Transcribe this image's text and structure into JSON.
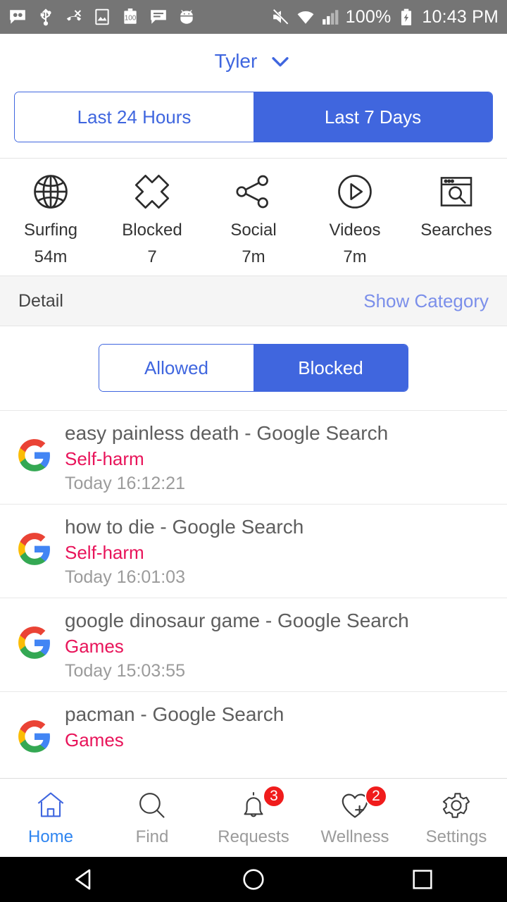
{
  "status_bar": {
    "icons": [
      "voicemail-icon",
      "usb-icon",
      "missed-call-icon",
      "image-icon",
      "battery-saver-100-icon",
      "message-icon",
      "android-bug-icon"
    ],
    "right_icons": [
      "mute-icon",
      "wifi-icon",
      "signal-icon",
      "battery-charging-icon"
    ],
    "battery_percent": "100%",
    "time": "10:43 PM",
    "background": "#757575"
  },
  "header": {
    "profile_name": "Tyler",
    "dropdown_icon": "chevron-down-icon",
    "accent": "#3F66DF"
  },
  "period_toggle": {
    "options": [
      {
        "label": "Last 24 Hours",
        "active": false
      },
      {
        "label": "Last 7 Days",
        "active": true
      }
    ],
    "accent": "#4066DE"
  },
  "stats": [
    {
      "icon": "globe-icon",
      "label": "Surfing",
      "value": "54m"
    },
    {
      "icon": "cross-icon",
      "label": "Blocked",
      "value": "7"
    },
    {
      "icon": "share-icon",
      "label": "Social",
      "value": "7m"
    },
    {
      "icon": "play-circle-icon",
      "label": "Videos",
      "value": "7m"
    },
    {
      "icon": "browser-search-icon",
      "label": "Searches",
      "value": ""
    }
  ],
  "detail_bar": {
    "title": "Detail",
    "action_label": "Show Category",
    "action_color": "#7B8FEA",
    "background": "#F5F5F5"
  },
  "filter_toggle": {
    "options": [
      {
        "label": "Allowed",
        "active": false
      },
      {
        "label": "Blocked",
        "active": true
      }
    ]
  },
  "list": {
    "category_color": "#E8145A",
    "rows": [
      {
        "icon": "google-icon",
        "title": "easy painless death - Google Search",
        "category": "Self-harm",
        "time": "Today 16:12:21"
      },
      {
        "icon": "google-icon",
        "title": "how to die - Google Search",
        "category": "Self-harm",
        "time": "Today 16:01:03"
      },
      {
        "icon": "google-icon",
        "title": "google dinosaur game - Google Search",
        "category": "Games",
        "time": "Today 15:03:55"
      },
      {
        "icon": "google-icon",
        "title": "pacman - Google Search",
        "category": "Games",
        "time": ""
      }
    ]
  },
  "bottom_nav": {
    "active_color": "#2F85F0",
    "items": [
      {
        "icon": "home-icon",
        "label": "Home",
        "active": true,
        "badge": ""
      },
      {
        "icon": "search-icon",
        "label": "Find",
        "active": false,
        "badge": ""
      },
      {
        "icon": "bell-icon",
        "label": "Requests",
        "active": false,
        "badge": "3"
      },
      {
        "icon": "heart-plus-icon",
        "label": "Wellness",
        "active": false,
        "badge": "2"
      },
      {
        "icon": "gear-icon",
        "label": "Settings",
        "active": false,
        "badge": ""
      }
    ]
  },
  "android_nav": {
    "buttons": [
      "back-icon",
      "home-circle-icon",
      "recents-square-icon"
    ]
  }
}
